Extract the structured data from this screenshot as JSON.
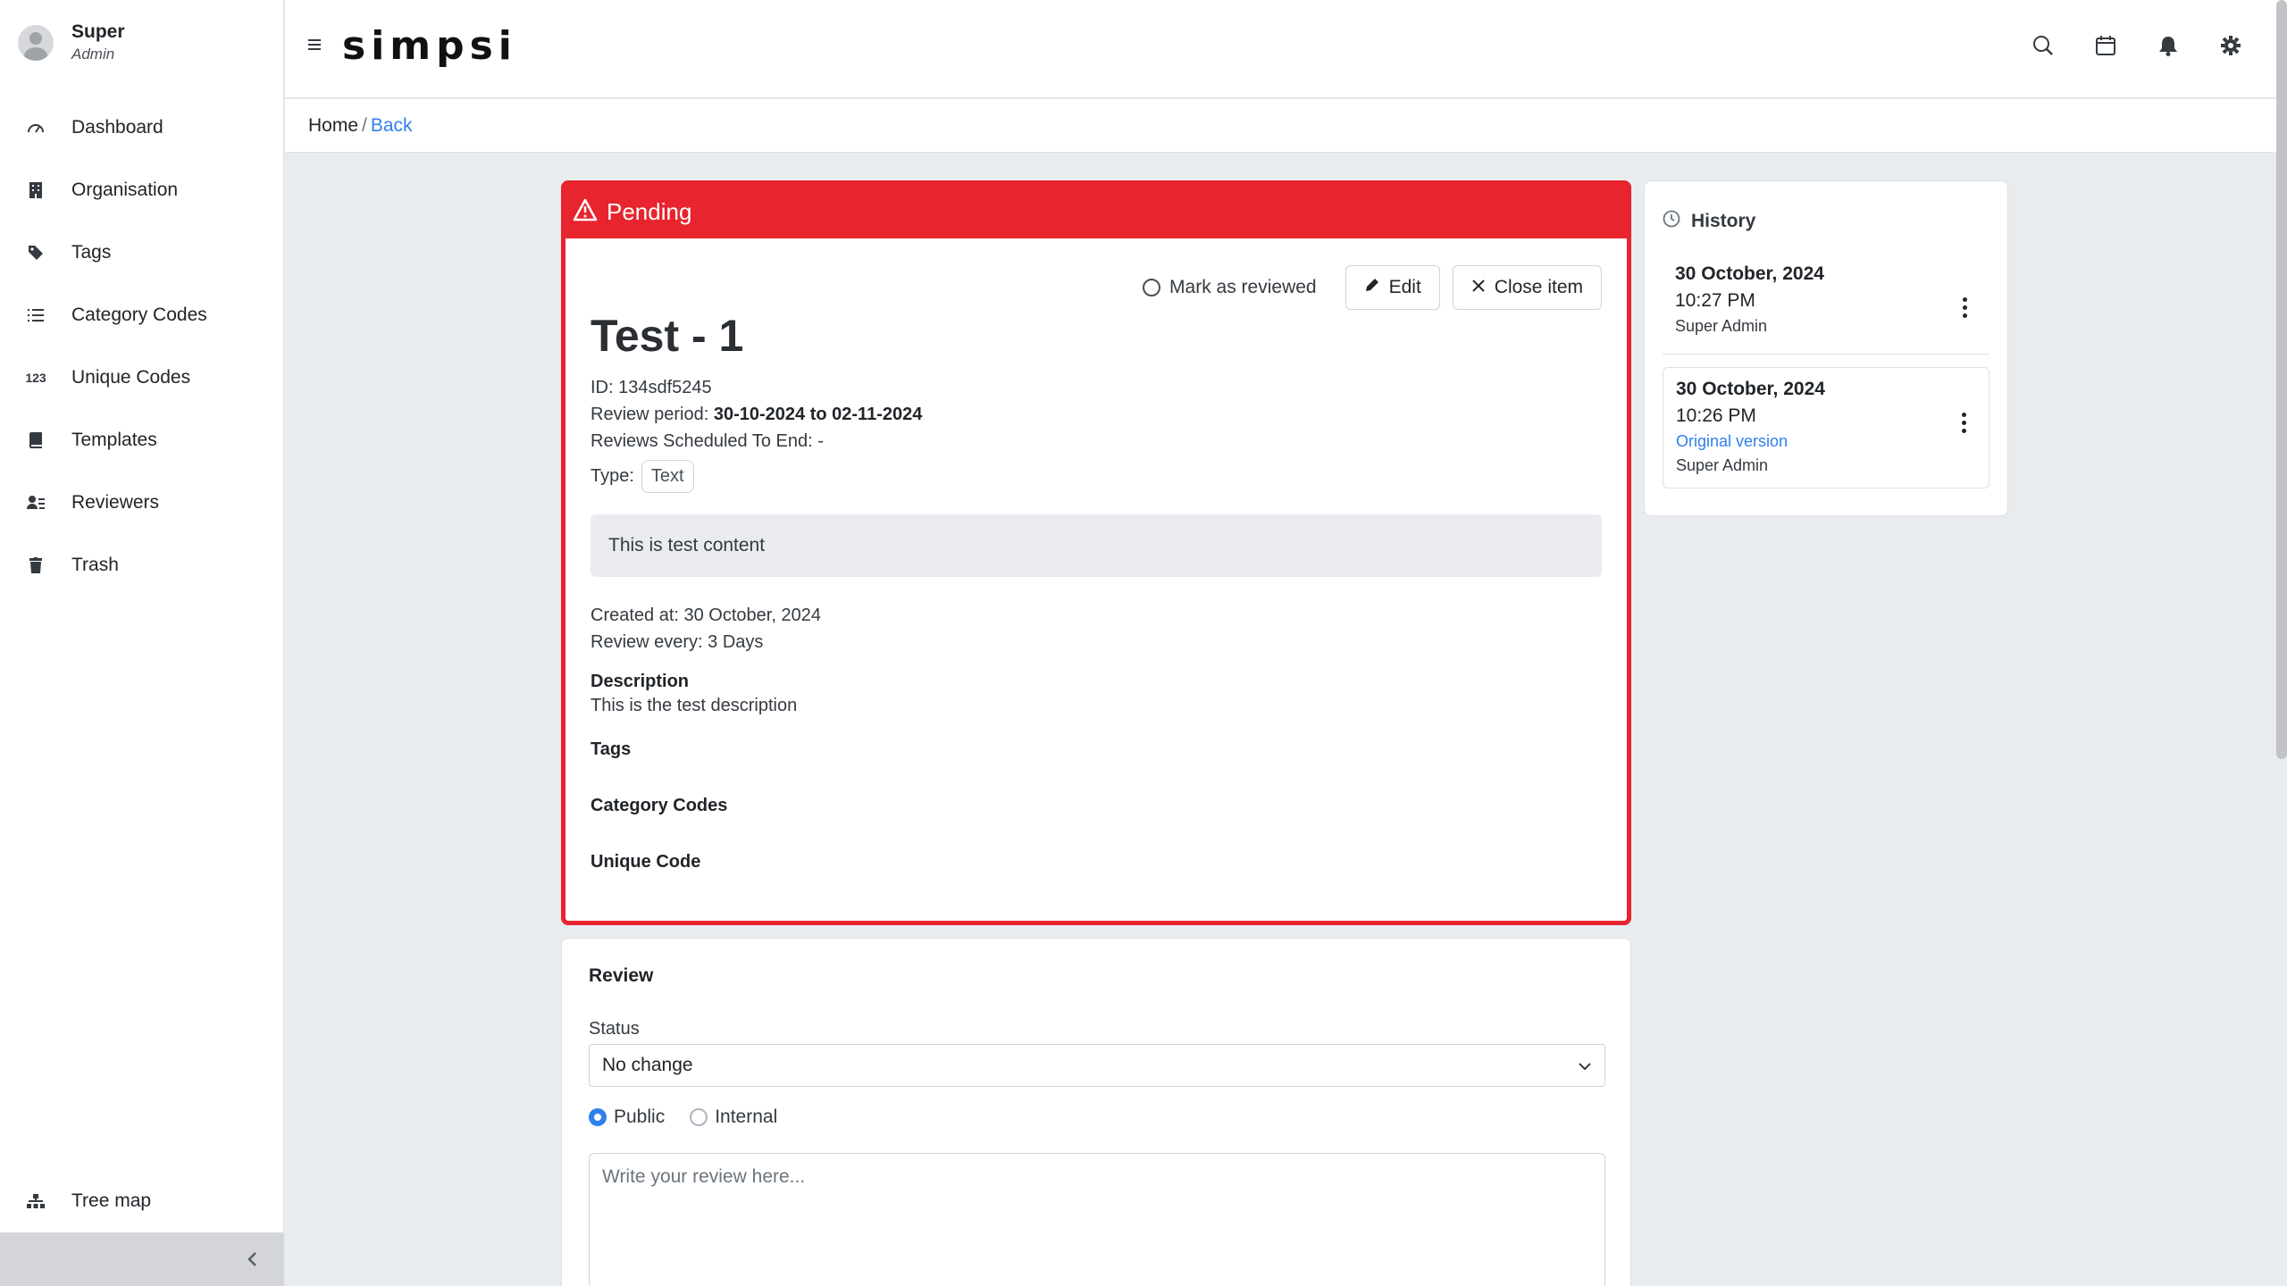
{
  "user": {
    "name": "Super",
    "role": "Admin"
  },
  "nav": [
    {
      "label": "Dashboard",
      "icon": "dashboard-icon"
    },
    {
      "label": "Organisation",
      "icon": "building-icon"
    },
    {
      "label": "Tags",
      "icon": "tags-icon"
    },
    {
      "label": "Category Codes",
      "icon": "list-icon"
    },
    {
      "label": "Unique Codes",
      "icon": "numbers-icon",
      "glyph": "123"
    },
    {
      "label": "Templates",
      "icon": "book-icon"
    },
    {
      "label": "Reviewers",
      "icon": "reviewers-icon"
    },
    {
      "label": "Trash",
      "icon": "trash-icon"
    }
  ],
  "treemap": {
    "label": "Tree map"
  },
  "brand": {
    "logo": "simpsi"
  },
  "breadcrumb": {
    "home": "Home",
    "separator": "/",
    "back": "Back"
  },
  "item": {
    "status": "Pending",
    "mark_reviewed": "Mark as reviewed",
    "edit": "Edit",
    "close": "Close item",
    "title": "Test - 1",
    "id_label": "ID:",
    "id": "134sdf5245",
    "period_label": "Review period:",
    "period": "30-10-2024 to 02-11-2024",
    "scheduled": "Reviews Scheduled To End: -",
    "type_label": "Type:",
    "type": "Text",
    "content": "This is test content",
    "created": "Created at: 30 October, 2024",
    "review_every": "Review every: 3 Days",
    "description_title": "Description",
    "description": "This is the test description",
    "tags_title": "Tags",
    "category_title": "Category Codes",
    "unique_title": "Unique Code"
  },
  "review": {
    "title": "Review",
    "status_label": "Status",
    "status_value": "No change",
    "public": "Public",
    "internal": "Internal",
    "placeholder": "Write your review here..."
  },
  "history": {
    "title": "History",
    "entries": [
      {
        "date": "30 October, 2024",
        "time": "10:27 PM",
        "user": "Super Admin"
      },
      {
        "date": "30 October, 2024",
        "time": "10:26 PM",
        "link": "Original version",
        "user": "Super Admin"
      }
    ]
  },
  "colors": {
    "pending": "#e8242e",
    "accent": "#2f80ed"
  }
}
